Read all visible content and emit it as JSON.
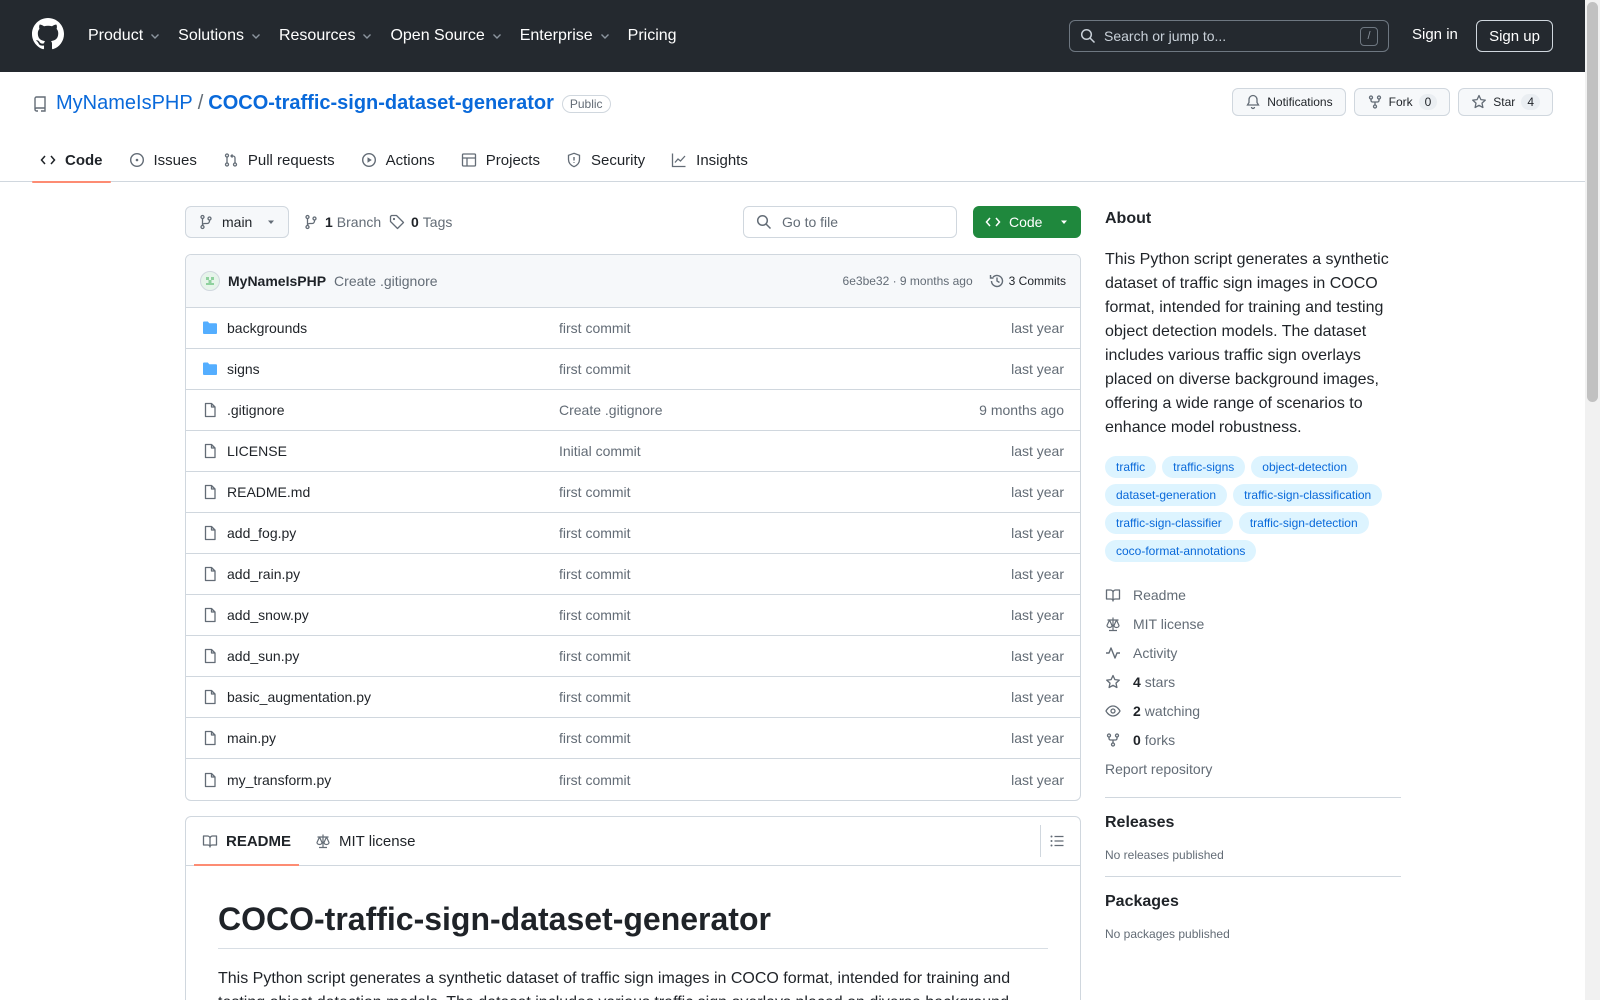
{
  "header": {
    "nav": [
      "Product",
      "Solutions",
      "Resources",
      "Open Source",
      "Enterprise",
      "Pricing"
    ],
    "search_placeholder": "Search or jump to...",
    "search_kbd": "/",
    "sign_in": "Sign in",
    "sign_up": "Sign up"
  },
  "repo": {
    "owner": "MyNameIsPHP",
    "slash": "/",
    "name": "COCO-traffic-sign-dataset-generator",
    "visibility": "Public",
    "notifications_label": "Notifications",
    "fork_label": "Fork",
    "fork_count": "0",
    "star_label": "Star",
    "star_count": "4",
    "tabs": [
      "Code",
      "Issues",
      "Pull requests",
      "Actions",
      "Projects",
      "Security",
      "Insights"
    ]
  },
  "browser": {
    "branch": "main",
    "branch_count": "1",
    "branch_label": "Branch",
    "tag_count": "0",
    "tag_label": "Tags",
    "goto_placeholder": "Go to file",
    "code_button": "Code",
    "commit": {
      "author": "MyNameIsPHP",
      "message": "Create .gitignore",
      "hash_time": "6e3be32 · 9 months ago",
      "commits_label": "3 Commits"
    },
    "files": [
      {
        "name": "backgrounds",
        "type": "dir",
        "message": "first commit",
        "date": "last year"
      },
      {
        "name": "signs",
        "type": "dir",
        "message": "first commit",
        "date": "last year"
      },
      {
        "name": ".gitignore",
        "type": "file",
        "message": "Create .gitignore",
        "date": "9 months ago"
      },
      {
        "name": "LICENSE",
        "type": "file",
        "message": "Initial commit",
        "date": "last year"
      },
      {
        "name": "README.md",
        "type": "file",
        "message": "first commit",
        "date": "last year"
      },
      {
        "name": "add_fog.py",
        "type": "file",
        "message": "first commit",
        "date": "last year"
      },
      {
        "name": "add_rain.py",
        "type": "file",
        "message": "first commit",
        "date": "last year"
      },
      {
        "name": "add_snow.py",
        "type": "file",
        "message": "first commit",
        "date": "last year"
      },
      {
        "name": "add_sun.py",
        "type": "file",
        "message": "first commit",
        "date": "last year"
      },
      {
        "name": "basic_augmentation.py",
        "type": "file",
        "message": "first commit",
        "date": "last year"
      },
      {
        "name": "main.py",
        "type": "file",
        "message": "first commit",
        "date": "last year"
      },
      {
        "name": "my_transform.py",
        "type": "file",
        "message": "first commit",
        "date": "last year"
      }
    ]
  },
  "readme": {
    "tab_readme": "README",
    "tab_license": "MIT license",
    "title": "COCO-traffic-sign-dataset-generator",
    "intro": "This Python script generates a synthetic dataset of traffic sign images in COCO format, intended for training and testing object detection models. The dataset includes various traffic sign overlays placed on diverse background images, offering a wide range of scenarios to enhance model robustness."
  },
  "sidebar": {
    "about_title": "About",
    "description": "This Python script generates a synthetic dataset of traffic sign images in COCO format, intended for training and testing object detection models. The dataset includes various traffic sign overlays placed on diverse background images, offering a wide range of scenarios to enhance model robustness.",
    "topics": [
      "traffic",
      "traffic-signs",
      "object-detection",
      "dataset-generation",
      "traffic-sign-classification",
      "traffic-sign-classifier",
      "traffic-sign-detection",
      "coco-format-annotations"
    ],
    "links": {
      "readme": "Readme",
      "license": "MIT license",
      "activity": "Activity",
      "stars_count": "4",
      "stars_label": "stars",
      "watching_count": "2",
      "watching_label": "watching",
      "forks_count": "0",
      "forks_label": "forks",
      "report": "Report repository"
    },
    "releases_title": "Releases",
    "releases_text": "No releases published",
    "packages_title": "Packages",
    "packages_text": "No packages published"
  },
  "colors": {
    "header_bg": "#24292f",
    "link": "#0969da",
    "primary_button": "#1f883d",
    "tab_underline": "#fd8c73",
    "topic_bg": "#ddf4ff"
  }
}
